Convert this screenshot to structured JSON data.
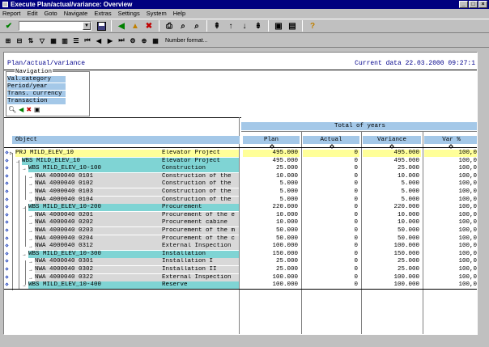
{
  "window": {
    "title": "Execute Plan/actual/variance: Overview"
  },
  "menu": [
    "Report",
    "Edit",
    "Goto",
    "Navigate",
    "Extras",
    "Settings",
    "System",
    "Help"
  ],
  "toolbar2": {
    "number_format_label": "Number format..."
  },
  "report": {
    "title": "Plan/actual/variance",
    "current_data": "Current data 22.03.2000 09:27:1"
  },
  "navigation": {
    "title": "Navigation",
    "items": [
      "Val.category",
      "Period/year",
      "Trans. currency",
      "Transaction"
    ]
  },
  "table": {
    "group_header": "Total of years",
    "object_header": "Object",
    "columns": [
      "Plan",
      "Actual",
      "Variance",
      "Var %"
    ],
    "rows": [
      {
        "object": "PRJ MILD_ELEV_10",
        "desc": "Elevator Project",
        "plan": "495.000",
        "actual": "0",
        "variance": "495.000",
        "varpct": "100,0",
        "level": 0,
        "color": "#ffff99"
      },
      {
        "object": "WBS MILD_ELEV_10",
        "desc": "Elevator Project",
        "plan": "495.000",
        "actual": "0",
        "variance": "495.000",
        "varpct": "100,0",
        "level": 1,
        "color": "#7fd4d4"
      },
      {
        "object": "WBS MILD_ELEV_10-100",
        "desc": "Construction",
        "plan": "25.000",
        "actual": "0",
        "variance": "25.000",
        "varpct": "100,0",
        "level": 2,
        "color": "#7fd4d4"
      },
      {
        "object": "NWA 4000040 0101",
        "desc": "Construction of the",
        "plan": "10.000",
        "actual": "0",
        "variance": "10.000",
        "varpct": "100,0",
        "level": 3,
        "color": "#d8d8d8"
      },
      {
        "object": "NWA 4000040 0102",
        "desc": "Construction of the",
        "plan": "5.000",
        "actual": "0",
        "variance": "5.000",
        "varpct": "100,0",
        "level": 3,
        "color": "#d8d8d8"
      },
      {
        "object": "NWA 4000040 0103",
        "desc": "Construction of the",
        "plan": "5.000",
        "actual": "0",
        "variance": "5.000",
        "varpct": "100,0",
        "level": 3,
        "color": "#d8d8d8"
      },
      {
        "object": "NWA 4000040 0104",
        "desc": "Construction of the",
        "plan": "5.000",
        "actual": "0",
        "variance": "5.000",
        "varpct": "100,0",
        "level": 3,
        "color": "#d8d8d8"
      },
      {
        "object": "WBS MILD_ELEV_10-200",
        "desc": "Procurement",
        "plan": "220.000",
        "actual": "0",
        "variance": "220.000",
        "varpct": "100,0",
        "level": 2,
        "color": "#7fd4d4"
      },
      {
        "object": "NWA 4000040 0201",
        "desc": "Procurement of the e",
        "plan": "10.000",
        "actual": "0",
        "variance": "10.000",
        "varpct": "100,0",
        "level": 3,
        "color": "#d8d8d8"
      },
      {
        "object": "NWA 4000040 0202",
        "desc": "Procurement cabine",
        "plan": "10.000",
        "actual": "0",
        "variance": "10.000",
        "varpct": "100,0",
        "level": 3,
        "color": "#d8d8d8"
      },
      {
        "object": "NWA 4000040 0203",
        "desc": "Procurement of the m",
        "plan": "50.000",
        "actual": "0",
        "variance": "50.000",
        "varpct": "100,0",
        "level": 3,
        "color": "#d8d8d8"
      },
      {
        "object": "NWA 4000040 0204",
        "desc": "Procurement of the c",
        "plan": "50.000",
        "actual": "0",
        "variance": "50.000",
        "varpct": "100,0",
        "level": 3,
        "color": "#d8d8d8"
      },
      {
        "object": "NWA 4000040 0312",
        "desc": "External Inspection",
        "plan": "100.000",
        "actual": "0",
        "variance": "100.000",
        "varpct": "100,0",
        "level": 3,
        "color": "#d8d8d8"
      },
      {
        "object": "WBS MILD_ELEV_10-300",
        "desc": "Installation",
        "plan": "150.000",
        "actual": "0",
        "variance": "150.000",
        "varpct": "100,0",
        "level": 2,
        "color": "#7fd4d4"
      },
      {
        "object": "NWA 4000040 0301",
        "desc": "Installation I",
        "plan": "25.000",
        "actual": "0",
        "variance": "25.000",
        "varpct": "100,0",
        "level": 3,
        "color": "#d8d8d8"
      },
      {
        "object": "NWA 4000040 0302",
        "desc": "Installation II",
        "plan": "25.000",
        "actual": "0",
        "variance": "25.000",
        "varpct": "100,0",
        "level": 3,
        "color": "#d8d8d8"
      },
      {
        "object": "NWA 4000040 0322",
        "desc": "External Inspection",
        "plan": "100.000",
        "actual": "0",
        "variance": "100.000",
        "varpct": "100,0",
        "level": 3,
        "color": "#d8d8d8"
      },
      {
        "object": "WBS MILD_ELEV_10-400",
        "desc": "Reserve",
        "plan": "100.000",
        "actual": "0",
        "variance": "100.000",
        "varpct": "100,0",
        "level": 2,
        "color": "#7fd4d4"
      }
    ]
  },
  "colors": {
    "title_bar": "#00007f",
    "header_blue": "#a4c8e8",
    "project_yellow": "#ffff99",
    "wbs_teal": "#7fd4d4"
  }
}
